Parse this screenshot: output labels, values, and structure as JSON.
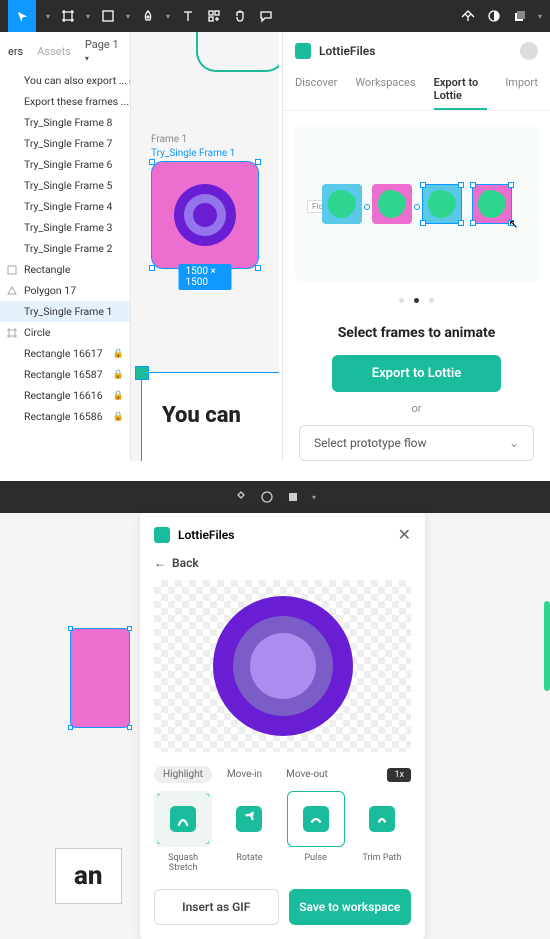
{
  "scr1": {
    "sidepanel": {
      "tabs": {
        "layers": "ers",
        "assets": "Assets"
      },
      "page_label": "Page 1",
      "layers": [
        {
          "label": "You can also export ...",
          "locked": true
        },
        {
          "label": "Export these frames ...",
          "locked": true
        },
        {
          "label": "Try_Single Frame 8"
        },
        {
          "label": "Try_Single Frame 7"
        },
        {
          "label": "Try_Single Frame 6"
        },
        {
          "label": "Try_Single Frame 5"
        },
        {
          "label": "Try_Single Frame 4"
        },
        {
          "label": "Try_Single Frame 3"
        },
        {
          "label": "Try_Single Frame 2"
        },
        {
          "label": "Rectangle",
          "icon": "rect"
        },
        {
          "label": "Polygon 17",
          "icon": "poly"
        },
        {
          "label": "Try_Single Frame 1",
          "selected": true
        },
        {
          "label": "Circle",
          "icon": "frame"
        },
        {
          "label": "Rectangle 16617",
          "locked": true
        },
        {
          "label": "Rectangle 16587",
          "locked": true
        },
        {
          "label": "Rectangle 16616",
          "locked": true
        },
        {
          "label": "Rectangle 16586",
          "locked": true
        }
      ]
    },
    "canvas": {
      "frame_label_top": "Frame 1",
      "frame_label": "Try_Single Frame 1",
      "dimensions": "1500 × 1500",
      "big_text": "You can"
    },
    "rpanel": {
      "title": "LottieFiles",
      "tabs": {
        "discover": "Discover",
        "workspaces": "Workspaces",
        "export": "Export to Lottie",
        "import": "Import"
      },
      "flow_label": "Flow 1",
      "heading": "Select frames to animate",
      "export_btn": "Export to Lottie",
      "or": "or",
      "select_placeholder": "Select prototype flow"
    }
  },
  "scr2": {
    "modal": {
      "title": "LottieFiles",
      "back": "Back",
      "chips": {
        "highlight": "Highlight",
        "movein": "Move-in",
        "moveout": "Move-out"
      },
      "speed": "1x",
      "anims": [
        {
          "label": "Squash Stretch"
        },
        {
          "label": "Rotate"
        },
        {
          "label": "Pulse",
          "selected": true
        },
        {
          "label": "Trim Path"
        }
      ],
      "insert_btn": "Insert as GIF",
      "save_btn": "Save to workspace"
    },
    "canvas": {
      "big_text": "an"
    }
  }
}
